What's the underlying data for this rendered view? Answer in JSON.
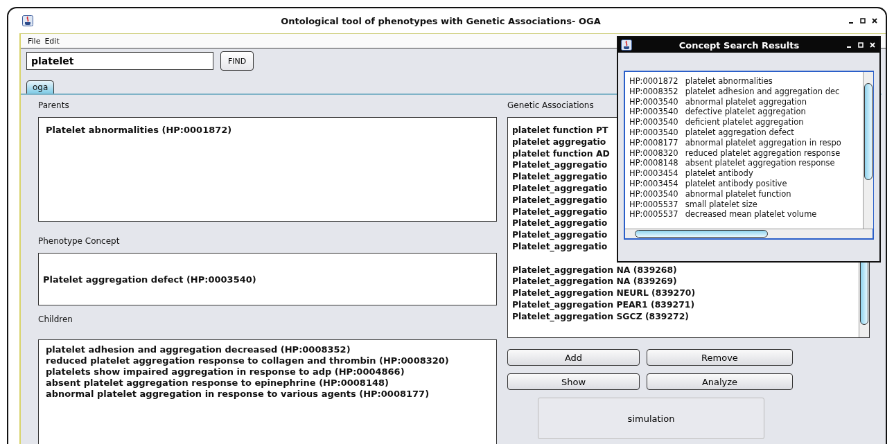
{
  "window": {
    "title": "Ontological tool of phenotypes with Genetic Associations- OGA"
  },
  "menu": [
    "File",
    "Edit"
  ],
  "search": {
    "value": "platelet",
    "button": "FIND"
  },
  "tabs": [
    {
      "label": "oga",
      "selected": true
    }
  ],
  "parents": {
    "label": "Parents",
    "items": [
      "Platelet abnormalities (HP:0001872)"
    ]
  },
  "phenotype_concept": {
    "label": "Phenotype Concept",
    "value": "Platelet aggregation defect (HP:0003540)"
  },
  "children": {
    "label": "Children",
    "items": [
      "platelet adhesion and aggregation decreased (HP:0008352)",
      "reduced platelet aggregation response to collagen and thrombin (HP:0008320)",
      "platelets show impaired aggregation in response to adp (HP:0004866)",
      "absent platelet aggregation response to epinephrine (HP:0008148)",
      "abnormal platelet aggregation in response to various agents (HP:0008177)"
    ]
  },
  "genetic_associations": {
    "label": "Genetic Associations",
    "items": [
      "platelet function PT",
      "platelet aggregatio",
      "platelet function AD",
      "Platelet_aggregatio",
      "Platelet_aggregatio",
      "Platelet_aggregatio",
      "Platelet_aggregatio",
      "Platelet_aggregatio",
      "Platelet_aggregatio",
      "Platelet_aggregatio",
      "Platelet_aggregatio"
    ],
    "items_below": [
      "Platelet_aggregation NA (839268)",
      "Platelet_aggregation NA (839269)",
      "Platelet_aggregation NEURL (839270)",
      "Platelet_aggregation PEAR1 (839271)",
      "Platelet_aggregation SGCZ (839272)"
    ]
  },
  "buttons": [
    "Add",
    "Remove",
    "Show",
    "Analyze"
  ],
  "simulation_button": "simulation",
  "search_results": {
    "title": "Concept Search Results",
    "rows": [
      {
        "id": "HP:0001872",
        "term": "platelet abnormalities"
      },
      {
        "id": "HP:0008352",
        "term": "platelet adhesion and aggregation dec"
      },
      {
        "id": "HP:0003540",
        "term": "abnormal platelet aggregation"
      },
      {
        "id": "HP:0003540",
        "term": "defective platelet aggregation"
      },
      {
        "id": "HP:0003540",
        "term": "deficient platelet aggregation"
      },
      {
        "id": "HP:0003540",
        "term": "platelet aggregation defect"
      },
      {
        "id": "HP:0008177",
        "term": "abnormal platelet aggregation in respo"
      },
      {
        "id": "HP:0008320",
        "term": "reduced platelet aggregation response"
      },
      {
        "id": "HP:0008148",
        "term": "absent platelet aggregation response"
      },
      {
        "id": "HP:0003454",
        "term": "platelet antibody"
      },
      {
        "id": "HP:0003454",
        "term": "platelet antibody positive"
      },
      {
        "id": "HP:0003540",
        "term": "abnormal platelet function"
      },
      {
        "id": "HP:0005537",
        "term": "small platelet size"
      },
      {
        "id": "HP:0005537",
        "term": "decreased mean platelet volume"
      }
    ]
  }
}
